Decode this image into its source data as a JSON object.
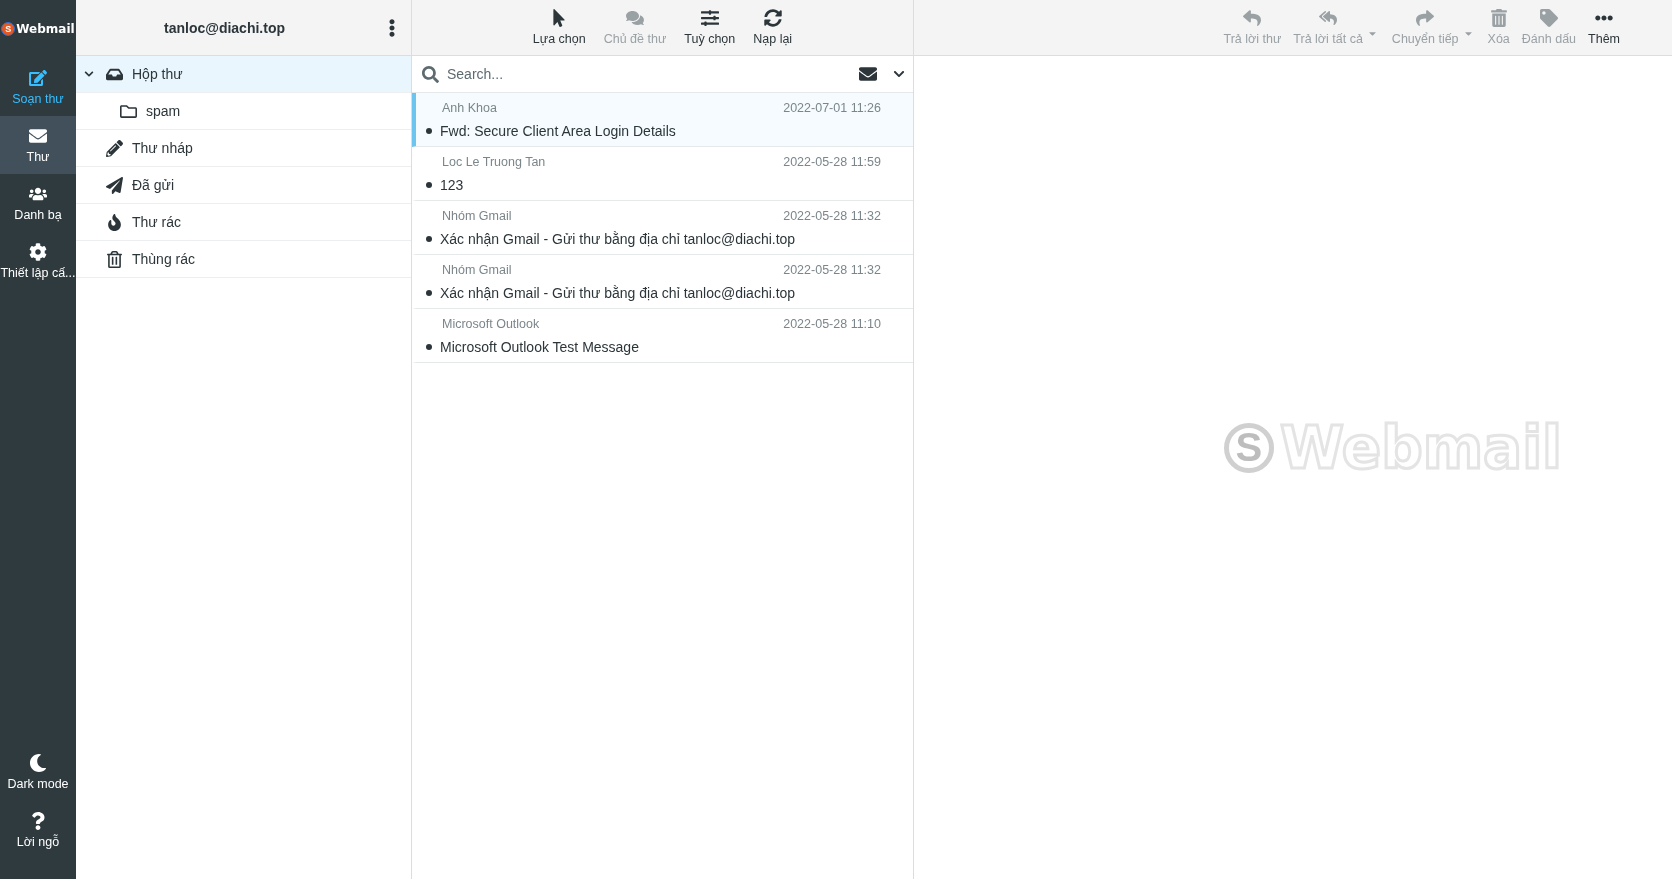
{
  "logo": {
    "mark": "S",
    "text": "Webmail"
  },
  "nav": [
    {
      "label": "Soạn thư",
      "kind": "compose",
      "selected": false
    },
    {
      "label": "Thư",
      "kind": "mail",
      "selected": true
    },
    {
      "label": "Danh bạ",
      "kind": "contacts",
      "selected": false
    },
    {
      "label": "Thiết lập cấ...",
      "kind": "settings",
      "selected": false
    }
  ],
  "nav_bottom": [
    {
      "label": "Dark mode",
      "kind": "moon"
    },
    {
      "label": "Lời ngỗ",
      "kind": "help"
    }
  ],
  "folders_header": {
    "account": "tanloc@diachi.top"
  },
  "folders": [
    {
      "name": "Hộp thư",
      "kind": "inbox",
      "selected": true,
      "expanded": true,
      "children": [
        {
          "name": "spam",
          "kind": "folder",
          "selected": false
        }
      ]
    },
    {
      "name": "Thư nháp",
      "kind": "drafts",
      "selected": false
    },
    {
      "name": "Đã gửi",
      "kind": "sent",
      "selected": false
    },
    {
      "name": "Thư rác",
      "kind": "junk",
      "selected": false
    },
    {
      "name": "Thùng rác",
      "kind": "trash",
      "selected": false
    }
  ],
  "list_toolbar": [
    {
      "label": "Lựa chọn",
      "kind": "select",
      "disabled": false
    },
    {
      "label": "Chủ đề thư",
      "kind": "threads",
      "disabled": true
    },
    {
      "label": "Tuỳ chọn",
      "kind": "options",
      "disabled": false
    },
    {
      "label": "Nạp lại",
      "kind": "refresh",
      "disabled": false
    }
  ],
  "search": {
    "placeholder": "Search..."
  },
  "messages": [
    {
      "from": "Anh Khoa",
      "date": "2022-07-01 11:26",
      "subject": "Fwd: Secure Client Area Login Details",
      "unread": true,
      "selected": true
    },
    {
      "from": "Loc Le Truong Tan",
      "date": "2022-05-28 11:59",
      "subject": "123",
      "unread": true,
      "selected": false
    },
    {
      "from": "Nhóm Gmail",
      "date": "2022-05-28 11:32",
      "subject": "Xác nhận Gmail - Gửi thư bằng địa chỉ tanloc@diachi.top",
      "unread": true,
      "selected": false
    },
    {
      "from": "Nhóm Gmail",
      "date": "2022-05-28 11:32",
      "subject": "Xác nhận Gmail - Gửi thư bằng địa chỉ tanloc@diachi.top",
      "unread": true,
      "selected": false
    },
    {
      "from": "Microsoft Outlook",
      "date": "2022-05-28 11:10",
      "subject": "Microsoft Outlook Test Message",
      "unread": true,
      "selected": false
    }
  ],
  "message_toolbar": [
    {
      "label": "Trả lời thư",
      "kind": "reply",
      "disabled": true,
      "dropdown": false
    },
    {
      "label": "Trả lời tất cả",
      "kind": "replyall",
      "disabled": true,
      "dropdown": true
    },
    {
      "label": "Chuyển tiếp",
      "kind": "forward",
      "disabled": true,
      "dropdown": true
    },
    {
      "label": "Xóa",
      "kind": "delete",
      "disabled": true,
      "dropdown": false
    },
    {
      "label": "Đánh dấu",
      "kind": "mark",
      "disabled": true,
      "dropdown": false
    },
    {
      "label": "Thêm",
      "kind": "more",
      "disabled": false,
      "dropdown": false
    }
  ],
  "preview": {
    "watermark_mark": "S",
    "watermark_text": "Webmail"
  }
}
